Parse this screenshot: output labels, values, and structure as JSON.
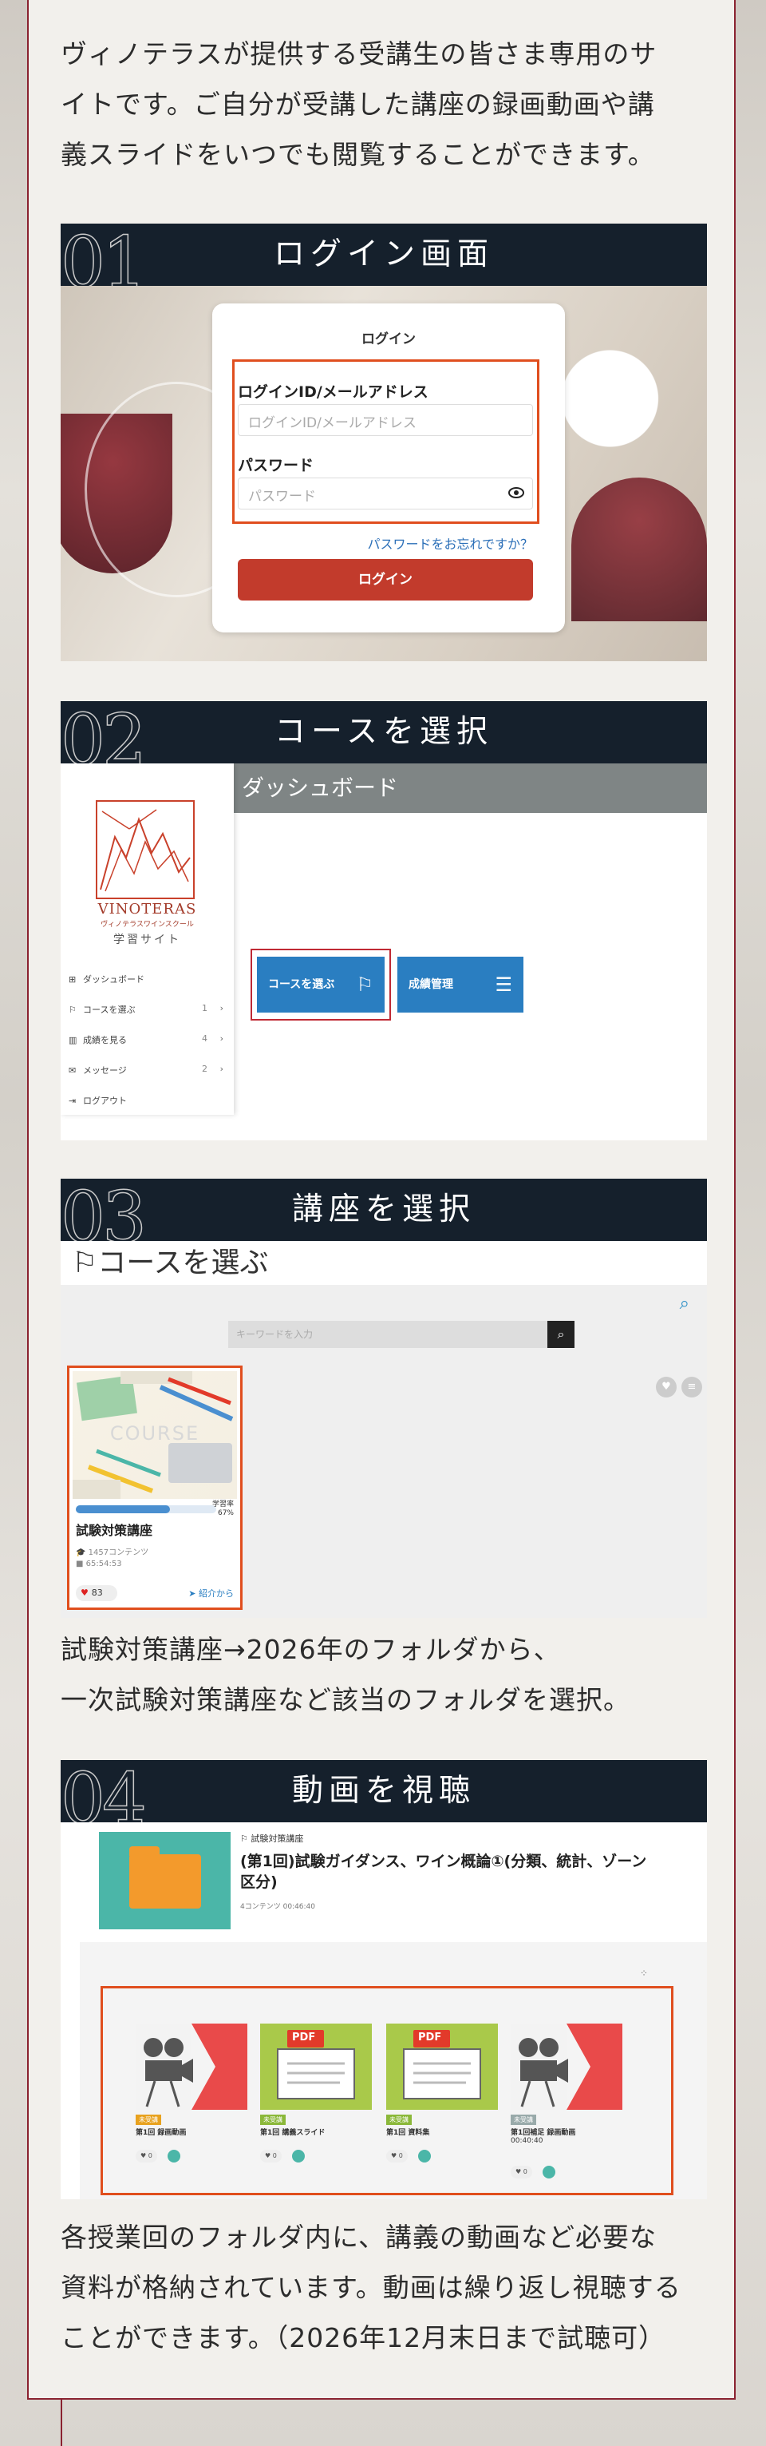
{
  "intro": {
    "line1": "ヴィノテラスが提供する受講生の皆さま専用のサ",
    "line2": "イトです。ご自分が受講した講座の録画動画や講",
    "line3": "義スライドをいつでも閲覧することができます。"
  },
  "steps": [
    {
      "num": "01",
      "title": "ログイン画面"
    },
    {
      "num": "02",
      "title": "コースを選択"
    },
    {
      "num": "03",
      "title": "講座を選択"
    },
    {
      "num": "04",
      "title": "動画を視聴"
    }
  ],
  "login": {
    "title": "ログイン",
    "id_label": "ログインID/メールアドレス",
    "id_placeholder": "ログインID/メールアドレス",
    "pw_label": "パスワード",
    "pw_placeholder": "パスワード",
    "forgot": "パスワードをお忘れですか？",
    "button": "ログイン",
    "eye_icon": "eye-icon"
  },
  "dashboard": {
    "title": "ダッシュボード",
    "logo_name": "VINOTERAS",
    "logo_sub": "ヴィノテラスワインスクール",
    "logo_caption": "学習サイト",
    "menu": [
      {
        "label": "ダッシュボード",
        "icon": "grid-icon",
        "count": ""
      },
      {
        "label": "コースを選ぶ",
        "icon": "flag-icon",
        "count": "1"
      },
      {
        "label": "成績を見る",
        "icon": "chart-icon",
        "count": "4"
      },
      {
        "label": "メッセージ",
        "icon": "chat-icon",
        "count": "2"
      },
      {
        "label": "ログアウト",
        "icon": "logout-icon",
        "count": ""
      }
    ],
    "btn_course": "コースを選ぶ",
    "btn_grades": "成績管理"
  },
  "course": {
    "page_title": "コースを選ぶ",
    "search_placeholder": "キーワードを入力",
    "card_badge": "COURSE",
    "progress_label": "学習率",
    "progress_value": "67%",
    "progress_fraction": 0.67,
    "card_title": "試験対策講座",
    "card_count": "1457コンテンツ",
    "card_duration": "65:54:53",
    "likes": "83",
    "share": "紹介から"
  },
  "para3": {
    "line1": "試験対策講座→2026年のフォルダから、",
    "line2": "一次試験対策講座など該当のフォルダを選択。"
  },
  "video": {
    "crumb": "試験対策講座",
    "title": "(第1回)試験ガイダンス、ワイン概論①(分類、統計、ゾーン区分)",
    "meta": "4コンテンツ  00:46:40",
    "items": [
      {
        "tag": "未受講",
        "label": "第1回 録画動画",
        "type": "video"
      },
      {
        "tag": "未受講",
        "label": "第1回 講義スライド",
        "type": "pdf"
      },
      {
        "tag": "未受講",
        "label": "第1回 資料集",
        "type": "pdf"
      },
      {
        "tag": "未受講",
        "label": "第1回補足 録画動画",
        "type": "video"
      }
    ],
    "pdf_text": "PDF",
    "item4_time": "00:40:40"
  },
  "para4": {
    "line1": "各授業回のフォルダ内に、講義の動画など必要な",
    "line2": "資料が格納されています。動画は繰り返し視聴する",
    "line3": "ことができます。（2026年12月末日まで試聴可）"
  },
  "colors": {
    "header_bg": "#15202c",
    "accent_orange": "#e04e1e",
    "frame_red": "#8a2230",
    "button_blue": "#2a7ec1",
    "login_red": "#c23b2c"
  }
}
